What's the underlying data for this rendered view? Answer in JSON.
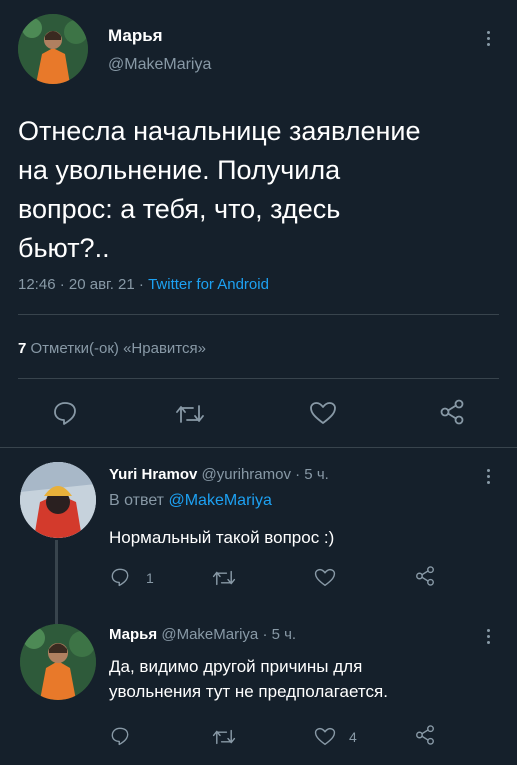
{
  "main_tweet": {
    "author_name": "Марья",
    "author_handle": "@MakeMariya",
    "text_lines": [
      "Отнесла начальнице заявление",
      "на увольнение. Получила",
      "вопрос: а тебя, что, здесь",
      "бьют?.."
    ],
    "time": "12:46",
    "date": "20 авг. 21",
    "dot": "·",
    "client": "Twitter for Android",
    "likes_count": "7",
    "likes_label": "Отметки(-ок) «Нравится»",
    "icons": [
      "reply-icon",
      "retweet-icon",
      "like-icon",
      "share-icon"
    ]
  },
  "replies": [
    {
      "author_name": "Yuri Hramov",
      "author_handle": "@yurihramov",
      "time": "· 5 ч.",
      "reply_to_prefix": "В ответ",
      "reply_to_handle": "@MakeMariya",
      "text_lines": [
        "Нормальный такой вопрос :)"
      ],
      "reply_count": "1",
      "retweet_count": "",
      "like_count": ""
    },
    {
      "author_name": "Марья",
      "author_handle": "@MakeMariya",
      "time": "· 5 ч.",
      "text_lines": [
        "Да, видимо другой причины для",
        "увольнения тут не предполагается."
      ],
      "reply_count": "",
      "retweet_count": "",
      "like_count": "4"
    }
  ],
  "colors": {
    "background": "#15202b",
    "text": "#ffffff",
    "muted": "#8899a6",
    "link": "#1da1f2",
    "divider": "#38444d"
  }
}
